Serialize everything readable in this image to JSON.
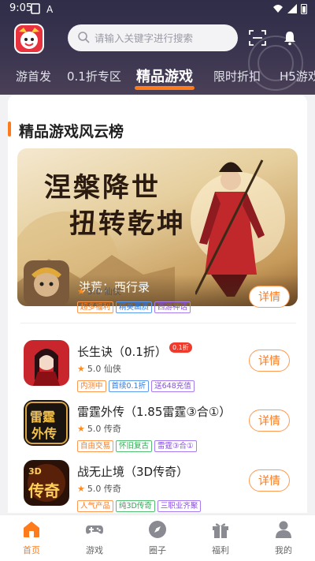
{
  "status": {
    "time": "9:05"
  },
  "header": {
    "search_placeholder": "请输入关键字进行搜索",
    "tabs": [
      {
        "label": "游首发"
      },
      {
        "label": "0.1折专区"
      },
      {
        "label": "精品游戏",
        "active": true
      },
      {
        "label": "限时折扣"
      },
      {
        "label": "H5游戏"
      }
    ]
  },
  "section": {
    "title": "精品游戏风云榜",
    "banner": {
      "calligraphy_line1": "涅槃降世",
      "calligraphy_line2": "扭转乾坤",
      "game_name": "洪荒：西行录"
    }
  },
  "games": [
    {
      "name": "洪荒：西行录",
      "rating": "5.0",
      "genre": "仙侠",
      "tags": [
        "超多福利",
        "精美画质",
        "西游神话"
      ],
      "detail_label": "详情"
    },
    {
      "name": "长生诀（0.1折）",
      "badge": "0.1折",
      "rating": "5.0",
      "genre": "仙侠",
      "tags": [
        "内测中",
        "首续0.1折",
        "送648充值"
      ],
      "detail_label": "详情"
    },
    {
      "name": "雷霆外传（1.85雷霆③合①）",
      "rating": "5.0",
      "genre": "传奇",
      "tags": [
        "自由交易",
        "怀旧复古",
        "雷霆③合①"
      ],
      "detail_label": "详情"
    },
    {
      "name": "战无止境（3D传奇）",
      "rating": "5.0",
      "genre": "传奇",
      "tags": [
        "人气产品",
        "纯3D传奇",
        "三职业齐聚"
      ],
      "detail_label": "详情"
    }
  ],
  "icon_text": {
    "g3_line1": "雷霆",
    "g3_line2": "外传",
    "g4_top": "3D",
    "g4_main": "传奇"
  },
  "bottom_nav": [
    {
      "label": "首页",
      "icon": "home-icon",
      "active": true
    },
    {
      "label": "游戏",
      "icon": "gamepad-icon"
    },
    {
      "label": "圈子",
      "icon": "compass-icon"
    },
    {
      "label": "福利",
      "icon": "gift-icon"
    },
    {
      "label": "我的",
      "icon": "user-icon"
    }
  ],
  "colors": {
    "accent": "#ff7a1a",
    "header_bg": "#2f2d48"
  }
}
